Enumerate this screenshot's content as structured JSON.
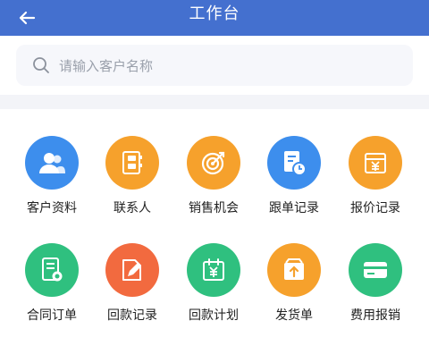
{
  "header": {
    "title": "工作台"
  },
  "search": {
    "placeholder": "请输入客户名称"
  },
  "grid": [
    {
      "label": "客户资料",
      "color": "#3d8eed",
      "icon": "users-icon"
    },
    {
      "label": "联系人",
      "color": "#f6a12c",
      "icon": "contacts-book-icon"
    },
    {
      "label": "销售机会",
      "color": "#f6a12c",
      "icon": "target-icon"
    },
    {
      "label": "跟单记录",
      "color": "#3d8eed",
      "icon": "document-clock-icon"
    },
    {
      "label": "报价记录",
      "color": "#f6a12c",
      "icon": "yuan-quote-icon"
    },
    {
      "label": "合同订单",
      "color": "#2fc07f",
      "icon": "contract-icon"
    },
    {
      "label": "回款记录",
      "color": "#f26a3f",
      "icon": "edit-document-icon"
    },
    {
      "label": "回款计划",
      "color": "#2fc07f",
      "icon": "yuan-calendar-icon"
    },
    {
      "label": "发货单",
      "color": "#f6a12c",
      "icon": "shipment-box-icon"
    },
    {
      "label": "费用报销",
      "color": "#2fc07f",
      "icon": "card-icon"
    }
  ]
}
